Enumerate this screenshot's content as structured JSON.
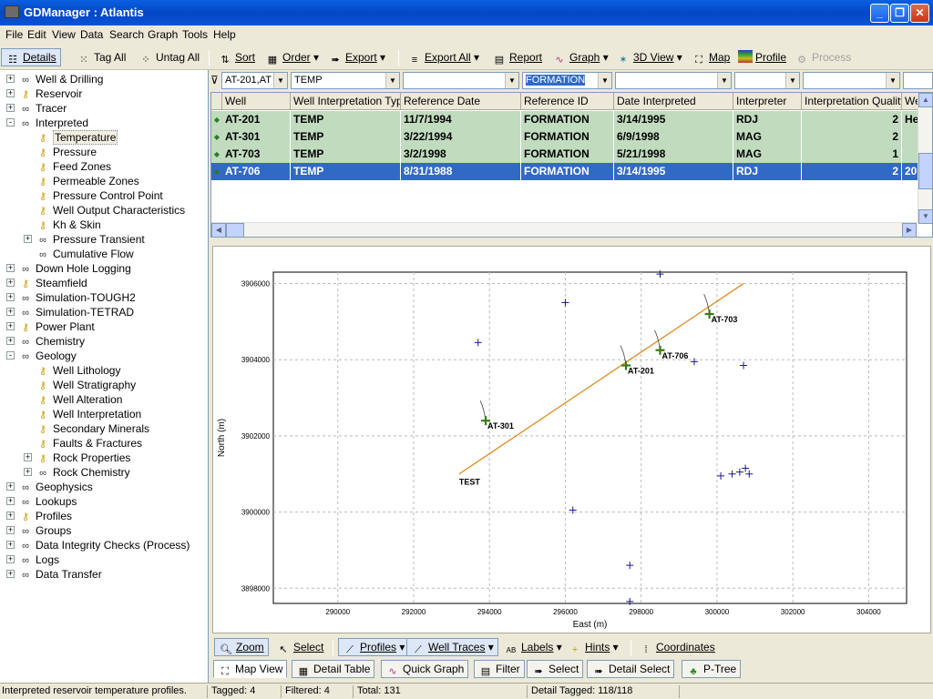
{
  "window": {
    "title": "GDManager : Atlantis"
  },
  "menu": [
    "File",
    "Edit",
    "View",
    "Data",
    "Search",
    "Graph",
    "Tools",
    "Help"
  ],
  "toolbar": {
    "details": "Details",
    "tag_all": "Tag All",
    "untag_all": "Untag All",
    "sort": "Sort",
    "order": "Order",
    "export": "Export",
    "export_all": "Export All",
    "report": "Report",
    "graph": "Graph",
    "view3d": "3D View",
    "map": "Map",
    "profile": "Profile",
    "process": "Process"
  },
  "tree": [
    {
      "label": "Well & Drilling",
      "level": 0,
      "expander": "+",
      "icon": "glasses-icon"
    },
    {
      "label": "Reservoir",
      "level": 0,
      "expander": "+",
      "icon": "key-icon"
    },
    {
      "label": "Tracer",
      "level": 0,
      "expander": "+",
      "icon": "glasses-icon"
    },
    {
      "label": "Interpreted",
      "level": 0,
      "expander": "-",
      "icon": "glasses-icon"
    },
    {
      "label": "Temperature",
      "level": 1,
      "expander": "",
      "icon": "key-icon",
      "selected": true
    },
    {
      "label": "Pressure",
      "level": 1,
      "expander": "",
      "icon": "key-icon"
    },
    {
      "label": "Feed Zones",
      "level": 1,
      "expander": "",
      "icon": "key-icon"
    },
    {
      "label": "Permeable Zones",
      "level": 1,
      "expander": "",
      "icon": "key-icon"
    },
    {
      "label": "Pressure Control Point",
      "level": 1,
      "expander": "",
      "icon": "key-icon"
    },
    {
      "label": "Well Output Characteristics",
      "level": 1,
      "expander": "",
      "icon": "key-icon"
    },
    {
      "label": "Kh & Skin",
      "level": 1,
      "expander": "",
      "icon": "key-icon"
    },
    {
      "label": "Pressure Transient",
      "level": 1,
      "expander": "+",
      "icon": "glasses-icon"
    },
    {
      "label": "Cumulative Flow",
      "level": 1,
      "expander": "",
      "icon": "glasses-icon"
    },
    {
      "label": "Down Hole Logging",
      "level": 0,
      "expander": "+",
      "icon": "glasses-icon"
    },
    {
      "label": "Steamfield",
      "level": 0,
      "expander": "+",
      "icon": "key-icon"
    },
    {
      "label": "Simulation-TOUGH2",
      "level": 0,
      "expander": "+",
      "icon": "glasses-icon"
    },
    {
      "label": "Simulation-TETRAD",
      "level": 0,
      "expander": "+",
      "icon": "glasses-icon"
    },
    {
      "label": "Power Plant",
      "level": 0,
      "expander": "+",
      "icon": "key-icon"
    },
    {
      "label": "Chemistry",
      "level": 0,
      "expander": "+",
      "icon": "glasses-icon"
    },
    {
      "label": "Geology",
      "level": 0,
      "expander": "-",
      "icon": "glasses-icon"
    },
    {
      "label": "Well Lithology",
      "level": 1,
      "expander": "",
      "icon": "key-icon"
    },
    {
      "label": "Well Stratigraphy",
      "level": 1,
      "expander": "",
      "icon": "key-icon"
    },
    {
      "label": "Well Alteration",
      "level": 1,
      "expander": "",
      "icon": "key-icon"
    },
    {
      "label": "Well Interpretation",
      "level": 1,
      "expander": "",
      "icon": "key-icon"
    },
    {
      "label": "Secondary Minerals",
      "level": 1,
      "expander": "",
      "icon": "key-icon"
    },
    {
      "label": "Faults & Fractures",
      "level": 1,
      "expander": "",
      "icon": "key-icon"
    },
    {
      "label": "Rock Properties",
      "level": 1,
      "expander": "+",
      "icon": "key-icon"
    },
    {
      "label": "Rock Chemistry",
      "level": 1,
      "expander": "+",
      "icon": "glasses-icon"
    },
    {
      "label": "Geophysics",
      "level": 0,
      "expander": "+",
      "icon": "glasses-icon"
    },
    {
      "label": "Lookups",
      "level": 0,
      "expander": "+",
      "icon": "glasses-icon"
    },
    {
      "label": "Profiles",
      "level": 0,
      "expander": "+",
      "icon": "key-icon"
    },
    {
      "label": "Groups",
      "level": 0,
      "expander": "+",
      "icon": "glasses-icon"
    },
    {
      "label": "Data Integrity Checks (Process)",
      "level": 0,
      "expander": "+",
      "icon": "glasses-icon"
    },
    {
      "label": "Logs",
      "level": 0,
      "expander": "+",
      "icon": "glasses-icon"
    },
    {
      "label": "Data Transfer",
      "level": 0,
      "expander": "+",
      "icon": "glasses-icon"
    }
  ],
  "filters": [
    "AT-201,AT",
    "TEMP",
    "",
    "FORMATION",
    "",
    "",
    ""
  ],
  "grid": {
    "columns": [
      "Well",
      "Well Interpretation Type",
      "Reference Date",
      "Reference ID",
      "Date Interpreted",
      "Interpreter",
      "Interpretation Quality",
      "We"
    ],
    "rows": [
      [
        "AT-201",
        "TEMP",
        "11/7/1994",
        "FORMATION",
        "3/14/1995",
        "RDJ",
        "2",
        "He"
      ],
      [
        "AT-301",
        "TEMP",
        "3/22/1994",
        "FORMATION",
        "6/9/1998",
        "MAG",
        "2",
        ""
      ],
      [
        "AT-703",
        "TEMP",
        "3/2/1998",
        "FORMATION",
        "5/21/1998",
        "MAG",
        "1",
        ""
      ],
      [
        "AT-706",
        "TEMP",
        "8/31/1988",
        "FORMATION",
        "3/14/1995",
        "RDJ",
        "2",
        "20"
      ]
    ],
    "selected_row": 3
  },
  "map": {
    "xlabel": "East (m)",
    "ylabel": "North (m)",
    "xticks": [
      "290000",
      "292000",
      "294000",
      "296000",
      "298000",
      "300000",
      "302000",
      "304000"
    ],
    "yticks": [
      "3898000",
      "3900000",
      "3902000",
      "3904000",
      "3906000"
    ],
    "xlim": [
      288300,
      305000
    ],
    "ylim": [
      3897600,
      3906300
    ],
    "profile_line": {
      "label": "TEST",
      "x1": 293200,
      "y1": 3901000,
      "x2": 300700,
      "y2": 3906000,
      "color": "#e08a1e"
    },
    "highlighted_wells": [
      {
        "name": "AT-301",
        "x": 293900,
        "y": 3902400
      },
      {
        "name": "AT-201",
        "x": 297600,
        "y": 3903850
      },
      {
        "name": "AT-706",
        "x": 298500,
        "y": 3904250
      },
      {
        "name": "AT-703",
        "x": 299800,
        "y": 3905200
      }
    ],
    "other_wells": [
      {
        "x": 293700,
        "y": 3904450
      },
      {
        "x": 296000,
        "y": 3905500
      },
      {
        "x": 298500,
        "y": 3906250
      },
      {
        "x": 299400,
        "y": 3903950
      },
      {
        "x": 300700,
        "y": 3903850
      },
      {
        "x": 296200,
        "y": 3900050
      },
      {
        "x": 297700,
        "y": 3898600
      },
      {
        "x": 297700,
        "y": 3897650
      },
      {
        "x": 300100,
        "y": 3900950
      },
      {
        "x": 300400,
        "y": 3901000
      },
      {
        "x": 300600,
        "y": 3901050
      },
      {
        "x": 300750,
        "y": 3901150
      },
      {
        "x": 300850,
        "y": 3901000
      }
    ]
  },
  "map_toolbar": {
    "zoom": "Zoom",
    "select": "Select",
    "profiles": "Profiles",
    "well_traces": "Well Traces",
    "labels": "Labels",
    "hints": "Hints",
    "coordinates": "Coordinates"
  },
  "tabs": [
    "Map View",
    "Detail Table",
    "Quick Graph",
    "Filter",
    "Select",
    "Detail Select",
    "P-Tree"
  ],
  "status": {
    "message": "Interpreted reservoir temperature profiles.",
    "tagged": "Tagged: 4",
    "filtered": "Filtered: 4",
    "total": "Total: 131",
    "detail_tagged": "Detail Tagged: 118/118"
  }
}
